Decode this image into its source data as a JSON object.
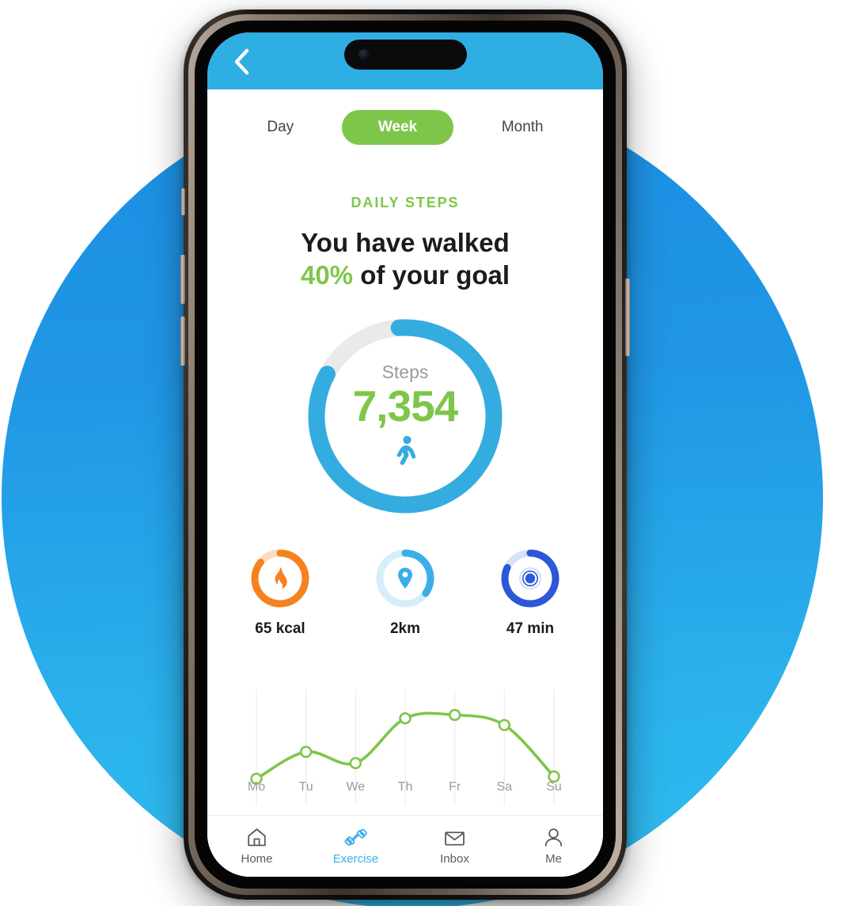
{
  "device": {
    "notch_icon": "front-camera-icon"
  },
  "header": {
    "back_icon": "back-chevron-icon",
    "background_color": "#2FAEE3"
  },
  "segmented_control": {
    "options": [
      {
        "label": "Day",
        "active": false
      },
      {
        "label": "Week",
        "active": true
      },
      {
        "label": "Month",
        "active": false
      }
    ],
    "active_color": "#7EC64A"
  },
  "summary": {
    "section_label": "DAILY STEPS",
    "headline_line1": "You have walked",
    "headline_percent": "40%",
    "headline_line2_rest": " of your goal",
    "label_color": "#7EC64A"
  },
  "main_ring": {
    "unit_label": "Steps",
    "value": "7,354",
    "percent": 40,
    "arc_fraction": 0.84,
    "icon": "walking-person-icon",
    "track_color": "#EAEAEA",
    "arc_color": "#35ACE0",
    "value_color": "#7EC64A",
    "label_color": "#9b9b9b"
  },
  "metrics": [
    {
      "id": "calories",
      "label": "65 kcal",
      "icon": "flame-icon",
      "arc_color": "#F5821F",
      "track_color": "#FBDCC0",
      "arc_fraction": 0.86
    },
    {
      "id": "distance",
      "label": "2km",
      "icon": "map-pin-icon",
      "arc_color": "#3BAEE8",
      "track_color": "#D6EDFA",
      "arc_fraction": 0.35
    },
    {
      "id": "duration",
      "label": "47 min",
      "icon": "target-icon",
      "arc_color": "#2B57D8",
      "track_color": "#D7E2F8",
      "arc_fraction": 0.82
    }
  ],
  "chart_data": {
    "type": "line",
    "title": "",
    "xlabel": "",
    "ylabel": "",
    "categories": [
      "Mo",
      "Tu",
      "We",
      "Th",
      "Fr",
      "Sa",
      "Su"
    ],
    "values": [
      4200,
      5400,
      4900,
      6900,
      7050,
      6600,
      4300
    ],
    "ylim": [
      3500,
      7600
    ],
    "grid": true,
    "grid_orientation": "vertical",
    "legend": "none",
    "line_color": "#7EC64A",
    "marker_fill": "#FFFFFF",
    "marker_stroke": "#7EC64A",
    "tick_label_color": "#9b9b9b",
    "gridline_color": "#EFEFEF",
    "curve": "smooth"
  },
  "bottom_nav": {
    "items": [
      {
        "label": "Home",
        "icon": "home-icon",
        "active": false
      },
      {
        "label": "Exercise",
        "icon": "dumbbell-icon",
        "active": true
      },
      {
        "label": "Inbox",
        "icon": "envelope-icon",
        "active": false
      },
      {
        "label": "Me",
        "icon": "person-icon",
        "active": false
      }
    ],
    "active_color": "#3BAEE8",
    "inactive_color": "#5a5a5a"
  }
}
